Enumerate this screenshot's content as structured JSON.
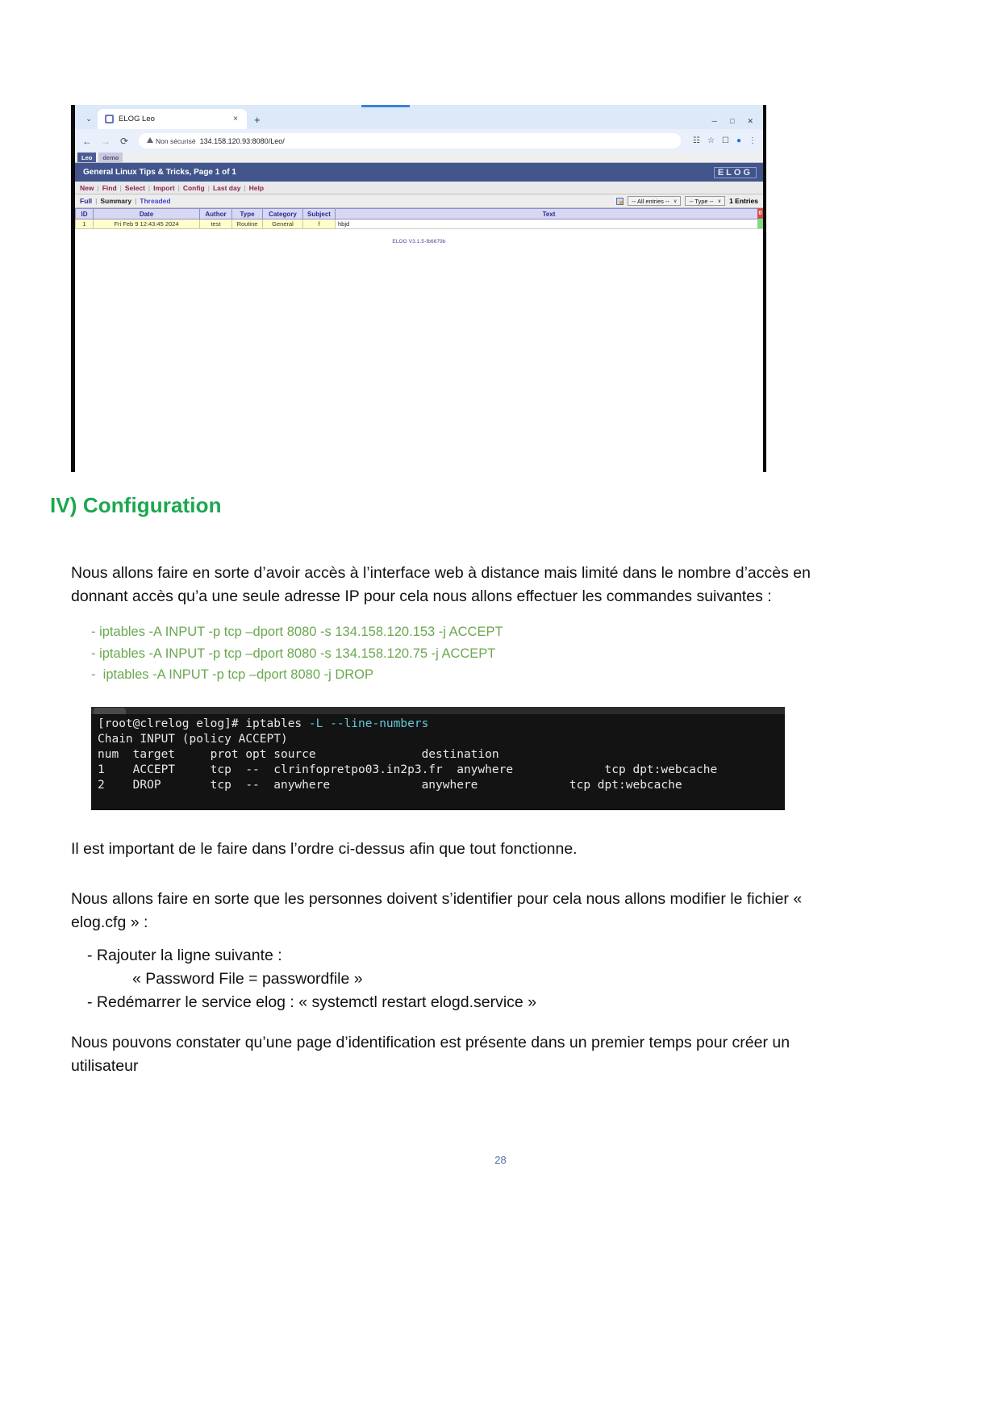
{
  "screenshot": {
    "browser": {
      "tab": {
        "title": "ELOG Leo",
        "close_label": "×",
        "favicon": "elog-favicon"
      },
      "new_tab_label": "+",
      "tab_list_chevron": "⌄",
      "nav": {
        "back": "←",
        "forward": "→",
        "reload": "⟳"
      },
      "omnibox": {
        "security_label": "Non sécurisé",
        "url": "134.158.120.93:8080/Leo/"
      },
      "toolbar_icons": [
        "translate-icon",
        "bookmark-star-icon",
        "sidepanel-icon",
        "profile-icon",
        "more-menu-icon"
      ],
      "window_controls": {
        "minimize": "─",
        "maximize": "□",
        "close": "✕"
      }
    },
    "elog": {
      "logbook_tabs": [
        {
          "label": "Leo",
          "selected": true
        },
        {
          "label": "demo",
          "selected": false
        }
      ],
      "page_title": "General Linux Tips & Tricks, Page 1 of 1",
      "logo": "ELOG",
      "menu": [
        "New",
        "Find",
        "Select",
        "Import",
        "Config",
        "Last day",
        "Help"
      ],
      "modes": [
        "Full",
        "Summary",
        "Threaded"
      ],
      "filters": {
        "entries_select": "-- All entries --",
        "type_select": "-- Type --",
        "chevron": "∨"
      },
      "entries_count": "1 Entries",
      "columns": [
        "ID",
        "Date",
        "Author",
        "Type",
        "Category",
        "Subject",
        "Text"
      ],
      "rows": [
        {
          "id": "1",
          "date": "Fri Feb 9 12:43:45 2024",
          "author": "test",
          "type": "Routine",
          "category": "General",
          "subject": "f",
          "text": "hbjd"
        }
      ],
      "version": "ELOG V3.1.5-fb6679b"
    }
  },
  "document": {
    "section_title": "IV) Configuration",
    "intro_paragraph": "Nous allons faire en sorte d’avoir accès à l’interface web à distance mais limité dans le nombre d’accès en donnant accès qu’a une seule adresse IP pour cela nous allons effectuer les commandes suivantes  :",
    "commands": [
      "iptables -A INPUT -p tcp –dport 8080 -s 134.158.120.153 -j ACCEPT",
      "iptables -A INPUT -p tcp –dport 8080 -s 134.158.120.75 -j ACCEPT",
      "iptables -A INPUT -p tcp –dport 8080 -j DROP"
    ],
    "terminal": {
      "prompt": "[root@clrelog elog]# iptables ",
      "command_args": "-L --line-numbers",
      "lines": [
        "Chain INPUT (policy ACCEPT)",
        "num  target     prot opt source               destination",
        "1    ACCEPT     tcp  --  clrinfopretpo03.in2p3.fr  anywhere             tcp dpt:webcache",
        "2    DROP       tcp  --  anywhere             anywhere             tcp dpt:webcache"
      ]
    },
    "order_paragraph": "Il est important de le faire dans l’ordre ci-dessus afin  que tout fonctionne.",
    "identify_paragraph": "Nous allons faire en sorte que les personnes doivent s’identifier pour cela nous allons modifier le fichier « elog.cfg » :",
    "steps": [
      "- Rajouter la ligne suivante :",
      "« Password File = passwordfile »",
      "- Redémarrer le service elog : « systemctl restart elogd.service »"
    ],
    "final_paragraph": "Nous pouvons constater qu’une page d’identification est présente dans un premier temps pour créer un utilisateur",
    "page_number": "28"
  },
  "colors": {
    "heading_green": "#1ba84f",
    "command_green": "#6aa84f",
    "elog_header_blue": "#41558c",
    "page_number_blue": "#4a6fa5"
  }
}
